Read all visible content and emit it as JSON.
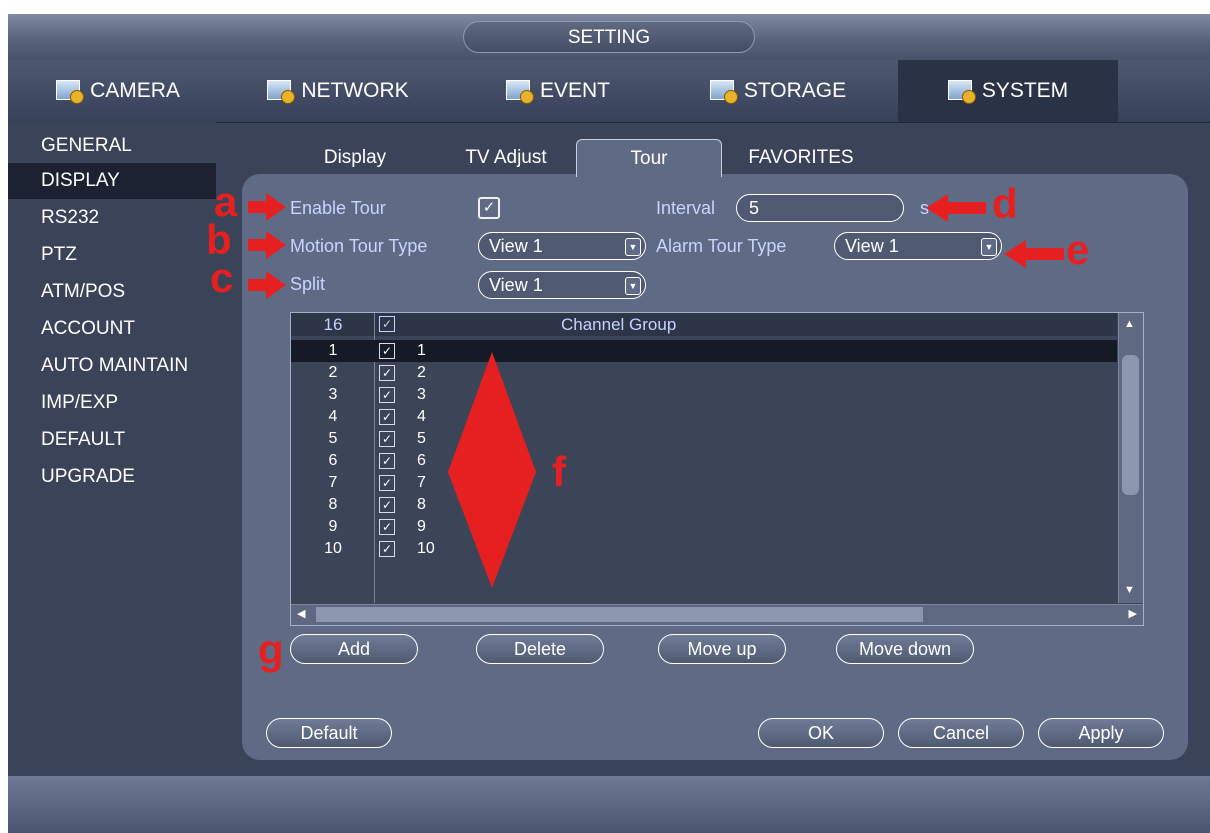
{
  "window": {
    "title": "SETTING"
  },
  "main_tabs": [
    {
      "label": "CAMERA",
      "icon": "camera-settings-icon"
    },
    {
      "label": "NETWORK",
      "icon": "network-icon"
    },
    {
      "label": "EVENT",
      "icon": "event-icon"
    },
    {
      "label": "STORAGE",
      "icon": "storage-icon"
    },
    {
      "label": "SYSTEM",
      "icon": "system-icon",
      "active": true
    }
  ],
  "sidebar": {
    "items": [
      {
        "label": "GENERAL"
      },
      {
        "label": "DISPLAY",
        "active": true
      },
      {
        "label": "RS232"
      },
      {
        "label": "PTZ"
      },
      {
        "label": "ATM/POS"
      },
      {
        "label": "ACCOUNT"
      },
      {
        "label": "AUTO MAINTAIN"
      },
      {
        "label": "IMP/EXP"
      },
      {
        "label": "DEFAULT"
      },
      {
        "label": "UPGRADE"
      }
    ]
  },
  "sub_tabs": [
    {
      "label": "Display"
    },
    {
      "label": "TV Adjust"
    },
    {
      "label": "Tour",
      "active": true
    },
    {
      "label": "FAVORITES"
    }
  ],
  "tour": {
    "enable_label": "Enable Tour",
    "enable_checked": "✓",
    "interval_label": "Interval",
    "interval_value": "5",
    "interval_unit": "s",
    "motion_label": "Motion Tour Type",
    "motion_value": "View 1",
    "alarm_label": "Alarm Tour Type",
    "alarm_value": "View 1",
    "split_label": "Split",
    "split_value": "View 1"
  },
  "table": {
    "header_count": "16",
    "header_check": "✓",
    "header_group": "Channel Group",
    "rows": [
      {
        "idx": "1",
        "check": "✓",
        "group": "1",
        "selected": true
      },
      {
        "idx": "2",
        "check": "✓",
        "group": "2"
      },
      {
        "idx": "3",
        "check": "✓",
        "group": "3"
      },
      {
        "idx": "4",
        "check": "✓",
        "group": "4"
      },
      {
        "idx": "5",
        "check": "✓",
        "group": "5"
      },
      {
        "idx": "6",
        "check": "✓",
        "group": "6"
      },
      {
        "idx": "7",
        "check": "✓",
        "group": "7"
      },
      {
        "idx": "8",
        "check": "✓",
        "group": "8"
      },
      {
        "idx": "9",
        "check": "✓",
        "group": "9"
      },
      {
        "idx": "10",
        "check": "✓",
        "group": "10"
      }
    ]
  },
  "buttons": {
    "add": "Add",
    "delete": "Delete",
    "move_up": "Move up",
    "move_down": "Move down",
    "default": "Default",
    "ok": "OK",
    "cancel": "Cancel",
    "apply": "Apply"
  },
  "annotations": {
    "a": "a",
    "b": "b",
    "c": "c",
    "d": "d",
    "e": "e",
    "f": "f",
    "g": "g"
  },
  "colors": {
    "accent_text": "#c9d4ff",
    "panel": "#5f6a84",
    "annotation": "#e62020"
  }
}
